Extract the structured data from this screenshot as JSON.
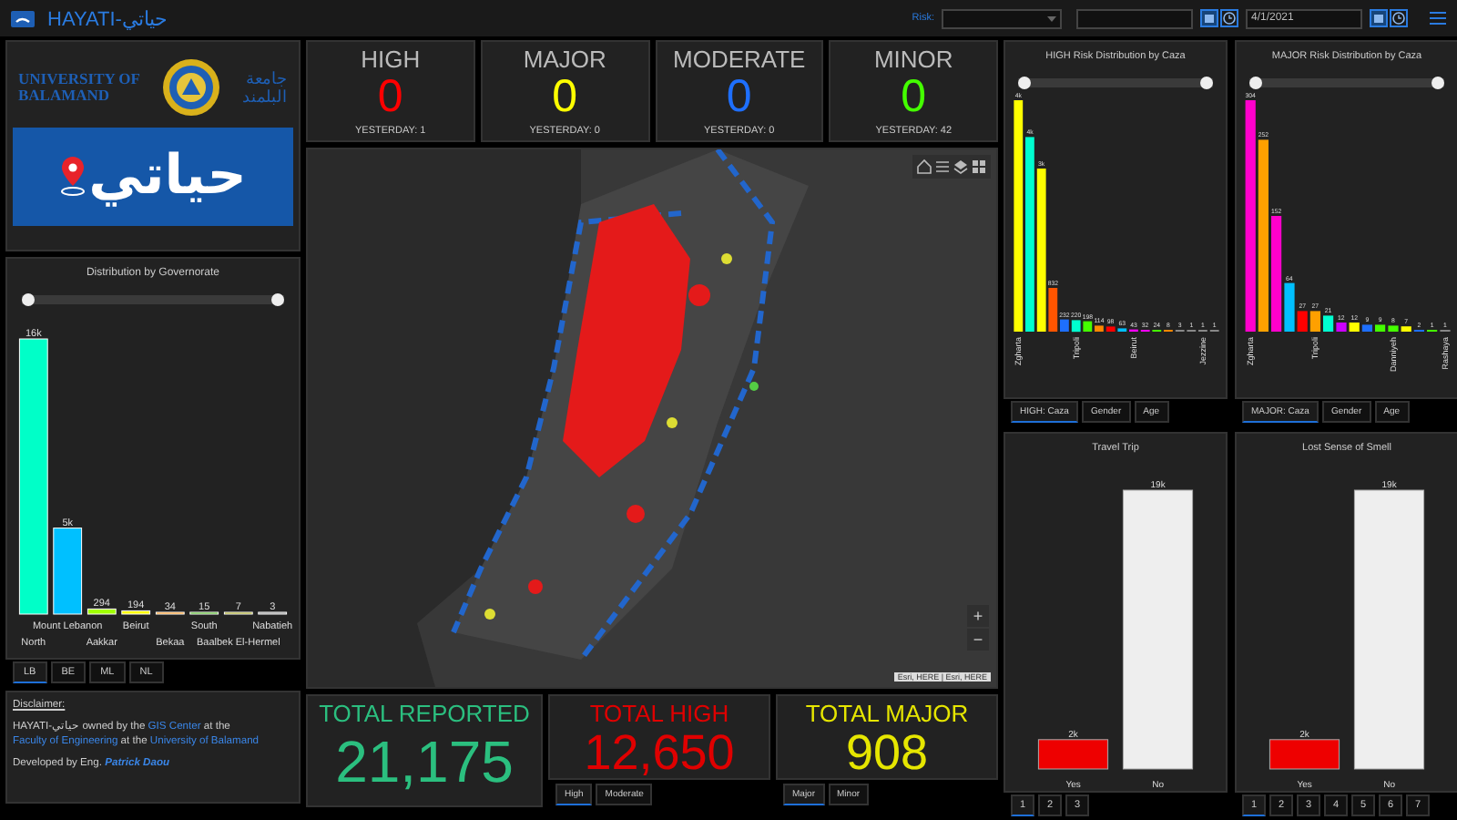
{
  "header": {
    "title": "HAYATI-حياتي",
    "risk_filter": {
      "label": "Risk:"
    },
    "end_date": "4/1/2021"
  },
  "logo_panel": {
    "university_en": [
      "UNIVERSITY OF",
      "BALAMAND"
    ],
    "university_ar": [
      "جامعة",
      "البلمند"
    ],
    "app_name": "حياتي"
  },
  "governorate_chart": {
    "title": "Distribution by Governorate",
    "chart_data": {
      "type": "bar",
      "categories": [
        "North",
        "Mount Lebanon",
        "Aakkar",
        "Beirut",
        "Bekaa",
        "South",
        "Baalbek El-Hermel",
        "Nabatieh"
      ],
      "values": [
        16000,
        5000,
        294,
        194,
        34,
        15,
        7,
        3
      ],
      "value_labels": [
        "16k",
        "5k",
        "294",
        "194",
        "34",
        "15",
        "7",
        "3"
      ],
      "colors": [
        "#00ffc8",
        "#00c0ff",
        "#a0ff00",
        "#ffff00",
        "#ff8800",
        "#33aa00",
        "#999900",
        "#888888"
      ]
    },
    "slider": {
      "start": {
        "level": 0
      },
      "end": {
        "level": 1
      }
    },
    "tabs": [
      {
        "label": "LB",
        "selected": true
      },
      {
        "label": "BE",
        "selected": false
      },
      {
        "label": "ML",
        "selected": false
      },
      {
        "label": "NL",
        "selected": false
      }
    ]
  },
  "stats": [
    {
      "label": "HIGH",
      "value": "0",
      "color": "#ff0000",
      "yesterday": "YESTERDAY: 1"
    },
    {
      "label": "MAJOR",
      "value": "0",
      "color": "#ffff00",
      "yesterday": "YESTERDAY: 0"
    },
    {
      "label": "MODERATE",
      "value": "0",
      "color": "#1e6fff",
      "yesterday": "YESTERDAY: 0"
    },
    {
      "label": "MINOR",
      "value": "0",
      "color": "#44ff00",
      "yesterday": "YESTERDAY: 42"
    }
  ],
  "map": {
    "zoom_in": "+",
    "zoom_out": "−",
    "attribution": "Esri, HERE | Esri, HERE"
  },
  "totals": [
    {
      "label": "TOTAL REPORTED",
      "value": "21,175",
      "color": "#2bbf7f"
    },
    {
      "label": "TOTAL HIGH",
      "value": "12,650",
      "color": "#e00000",
      "tabs": [
        {
          "label": "High",
          "selected": true
        },
        {
          "label": "Moderate",
          "selected": false
        }
      ]
    },
    {
      "label": "TOTAL MAJOR",
      "value": "908",
      "color": "#e6e600",
      "tabs": [
        {
          "label": "Major",
          "selected": true
        },
        {
          "label": "Minor",
          "selected": false
        }
      ]
    }
  ],
  "caza_charts": [
    {
      "title": "HIGH Risk Distribution by Caza",
      "chart_data": {
        "type": "bar",
        "values": [
          4400,
          3700,
          3100,
          832,
          232,
          220,
          198,
          114,
          98,
          63,
          43,
          32,
          24,
          8,
          3,
          1,
          1,
          1
        ],
        "value_labels": [
          "4k",
          "4k",
          "3k",
          "832",
          "232",
          "220",
          "198",
          "114",
          "98",
          "63",
          "43",
          "32",
          "24",
          "8",
          "3",
          "1",
          "1",
          "1"
        ],
        "colors": [
          "#ffff00",
          "#00ffd0",
          "#ffff00",
          "#ff5500",
          "#1e6fff",
          "#00ffd0",
          "#44ff00",
          "#ff8800",
          "#ff0000",
          "#00c0ff",
          "#ff00ff",
          "#ff00ff",
          "#44ff00",
          "#ff8800",
          "#888888",
          "#888888",
          "#888888",
          "#888888"
        ],
        "categories": [
          "Zgharta",
          null,
          null,
          null,
          null,
          "Tripoli",
          null,
          null,
          null,
          null,
          "Beirut",
          null,
          null,
          null,
          null,
          null,
          "Jezzine",
          null
        ]
      },
      "slider": {
        "start": {
          "level": 0
        },
        "end": {
          "level": 1
        }
      },
      "tabs": [
        {
          "label": "HIGH: Caza",
          "selected": true
        },
        {
          "label": "Gender",
          "selected": false
        },
        {
          "label": "Age",
          "selected": false
        }
      ]
    },
    {
      "title": "MAJOR Risk Distribution by Caza",
      "chart_data": {
        "type": "bar",
        "values": [
          304,
          252,
          152,
          64,
          27,
          27,
          21,
          12,
          12,
          9,
          9,
          8,
          7,
          2,
          1,
          1
        ],
        "value_labels": [
          "304",
          "252",
          "152",
          "64",
          "27",
          "27",
          "21",
          "12",
          "12",
          "9",
          "9",
          "8",
          "7",
          "2",
          "1",
          "1"
        ],
        "colors": [
          "#ff00cc",
          "#ffa000",
          "#ff00cc",
          "#00c0ff",
          "#ff0000",
          "#ffa000",
          "#00ffd0",
          "#cc00ff",
          "#ffff00",
          "#1e6fff",
          "#44ff00",
          "#44ff00",
          "#ffff00",
          "#1e6fff",
          "#44ff00",
          "#888888"
        ],
        "categories": [
          "Zgharta",
          null,
          null,
          null,
          null,
          "Tripoli",
          null,
          null,
          null,
          null,
          null,
          "Danniyeh",
          null,
          null,
          null,
          "Rashaya"
        ]
      },
      "slider": {
        "start": {
          "level": 0
        },
        "end": {
          "level": 1
        }
      },
      "tabs": [
        {
          "label": "MAJOR: Caza",
          "selected": true
        },
        {
          "label": "Gender",
          "selected": false
        },
        {
          "label": "Age",
          "selected": false
        }
      ]
    }
  ],
  "symptom_charts": [
    {
      "title": "Travel Trip",
      "chart_data": {
        "type": "bar",
        "categories": [
          "Yes",
          "No"
        ],
        "values": [
          2000,
          19000
        ],
        "value_labels": [
          "2k",
          "19k"
        ],
        "colors": [
          "#ee0000",
          "#eeeeee"
        ]
      },
      "pages": [
        {
          "label": "1",
          "selected": true
        },
        {
          "label": "2",
          "selected": false
        },
        {
          "label": "3",
          "selected": false
        }
      ]
    },
    {
      "title": "Lost Sense of Smell",
      "chart_data": {
        "type": "bar",
        "categories": [
          "Yes",
          "No"
        ],
        "values": [
          2000,
          19000
        ],
        "value_labels": [
          "2k",
          "19k"
        ],
        "colors": [
          "#ee0000",
          "#eeeeee"
        ]
      },
      "pages": [
        {
          "label": "1",
          "selected": true
        },
        {
          "label": "2",
          "selected": false
        },
        {
          "label": "3",
          "selected": false
        },
        {
          "label": "4",
          "selected": false
        },
        {
          "label": "5",
          "selected": false
        },
        {
          "label": "6",
          "selected": false
        },
        {
          "label": "7",
          "selected": false
        }
      ]
    }
  ],
  "disclaimer": {
    "heading": "Disclaimer:",
    "paragraph": [
      {
        "text": "HAYATI-حياتي owned by the "
      },
      {
        "link": "GIS Center"
      },
      {
        "text": " at the "
      },
      {
        "link": "Faculty of Engineering"
      },
      {
        "text": " at the "
      },
      {
        "link": "University of Balamand"
      }
    ],
    "credit": [
      {
        "text": "Developed by Eng. "
      },
      {
        "link": "Patrick Daou"
      }
    ]
  }
}
